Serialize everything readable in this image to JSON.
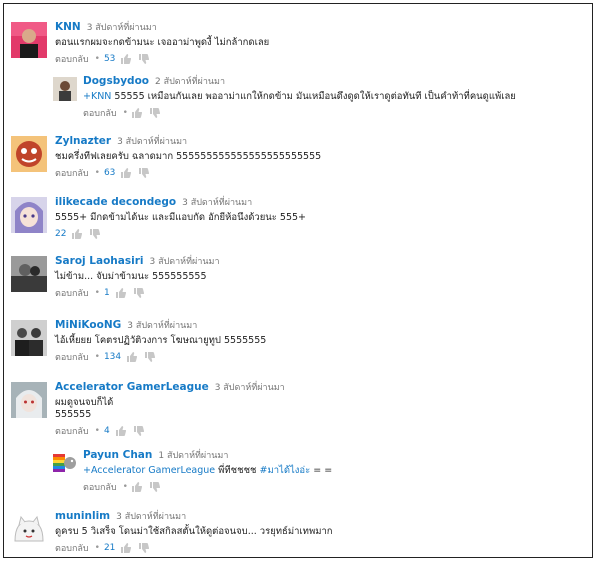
{
  "reply_label": "ตอบกลับ",
  "comments": [
    {
      "author": "KNN",
      "time": "3 สัปดาห์ที่ผ่านมา",
      "text": "ตอนแรกผมจะกดข้ามนะ เจออาม่าพูดงี้ ไม่กล้ากดเลย",
      "likes": "53",
      "avatar_icon": "person-dark-shirt-avatar"
    },
    {
      "author": "Dogsbydoo",
      "time": "2 สัปดาห์ที่ผ่านมา",
      "mention": "+KNN",
      "text": " 55555 เหมือนกันเลย พออาม่าแกให้กดข้าม มันเหมือนดึงดูดให้เราดูต่อทันที เป็นคำท้าที่คนดูแพ้เลย",
      "likes": "",
      "avatar_icon": "portrait-photo-avatar"
    },
    {
      "author": "Zylnazter",
      "time": "3 สัปดาห์ที่ผ่านมา",
      "text": "ชมครึ่งทีฟเลยครับ ฉลาดมาก 555555555555555555555555",
      "likes": "63",
      "avatar_icon": "cartoon-face-avatar"
    },
    {
      "author": "ilikecade decondego",
      "time": "3 สัปดาห์ที่ผ่านมา",
      "text": "5555+ มีกดข้ามได้นะ และมีแอบกัด อักยีห้อนึงด้วยนะ 555+",
      "likes": "22",
      "avatar_icon": "anime-girl-avatar"
    },
    {
      "author": "Saroj Laohasiri",
      "time": "3 สัปดาห์ที่ผ่านมา",
      "text": "ไม่ข้าม... จับม่าข้ามนะ 555555555",
      "likes": "1",
      "avatar_icon": "bw-photo-avatar"
    },
    {
      "author": "MiNiKooNG",
      "time": "3 สัปดาห์ที่ผ่านมา",
      "text": "ไอ้เหี้ยยย โคตรปฏิวัติวงการ โฆษณายูทูป 5555555",
      "likes": "134",
      "avatar_icon": "group-photo-avatar"
    },
    {
      "author": "Accelerator GamerLeague",
      "time": "3 สัปดาห์ที่ผ่านมา",
      "text": "ผมดูจนจบก็ได้",
      "text2": "555555",
      "likes": "4",
      "avatar_icon": "anime-character-avatar"
    },
    {
      "author": "Payun Chan",
      "time": "1 สัปดาห์ที่ผ่านมา",
      "mention": "+Accelerator GamerLeague",
      "text": " พี่ทีชชชช ",
      "tag": "#มาได้ไงอ่ะ",
      "text_end": " = =",
      "likes": "",
      "avatar_icon": "rainbow-bird-avatar"
    },
    {
      "author": "muninlim",
      "time": "3 สัปดาห์ที่ผ่านมา",
      "text": "ดูครบ 5 วิเสร็จ โดนม่าใช้สกิลสตั้นให้ดูต่อจนจบ... วรยุทธ์ม่าเทพมาก",
      "likes": "21",
      "avatar_icon": "cartoon-cat-avatar"
    }
  ]
}
